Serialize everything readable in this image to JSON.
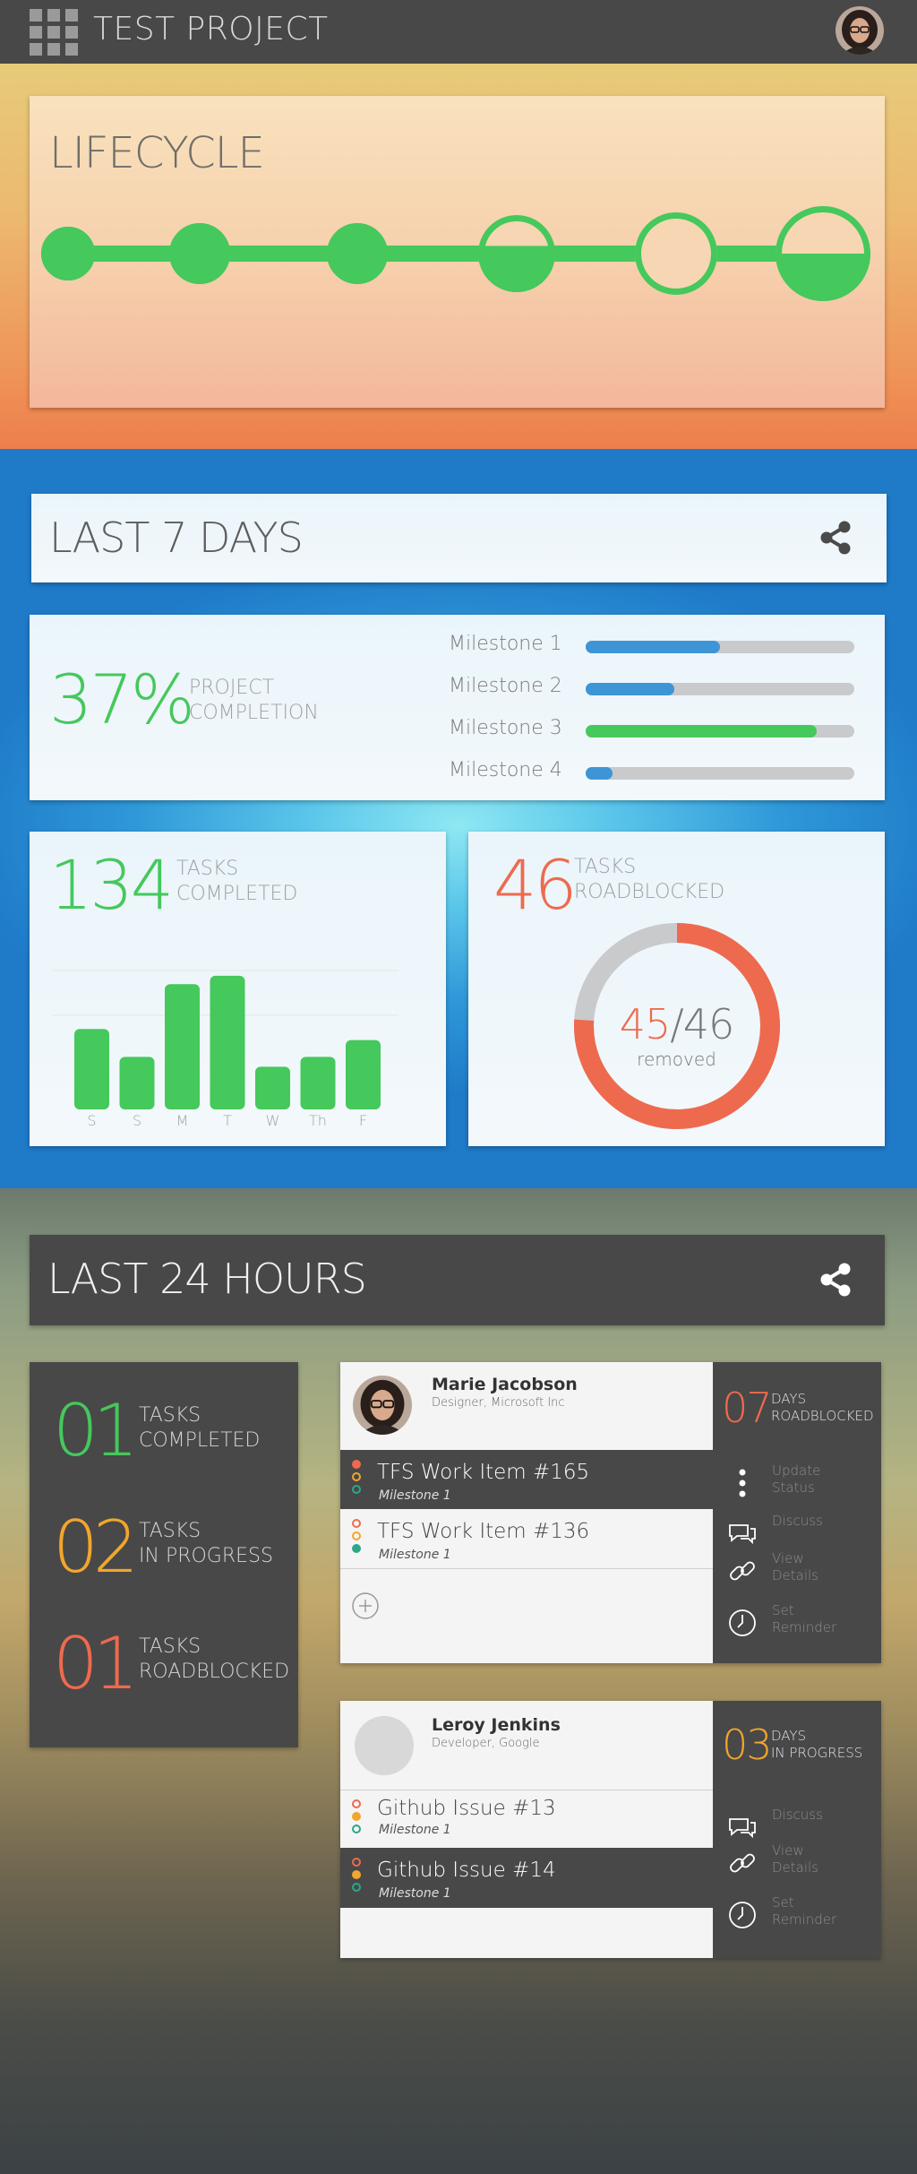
{
  "topbar": {
    "title": "TEST PROJECT"
  },
  "lifecycle": {
    "title": "LIFECYCLE",
    "stages": [
      {
        "fill": 1.0
      },
      {
        "fill": 1.0
      },
      {
        "fill": 1.0
      },
      {
        "fill": 0.6
      },
      {
        "fill": 0.0
      },
      {
        "fill": 0.5
      }
    ]
  },
  "last7": {
    "title": "LAST 7 DAYS",
    "completion": {
      "value": "37%",
      "label_line1": "PROJECT",
      "label_line2": "COMPLETION"
    },
    "milestones": [
      {
        "label": "Milestone 1",
        "progress": 0.5,
        "color": "#3d95d6"
      },
      {
        "label": "Milestone 2",
        "progress": 0.33,
        "color": "#3d95d6"
      },
      {
        "label": "Milestone 3",
        "progress": 0.86,
        "color": "#45c85c"
      },
      {
        "label": "Milestone 4",
        "progress": 0.1,
        "color": "#3d95d6"
      }
    ],
    "tasks_completed": {
      "value": "134",
      "label_line1": "TASKS",
      "label_line2": "COMPLETED"
    },
    "tasks_roadblocked": {
      "value": "46",
      "label_line1": "TASKS",
      "label_line2": "ROADBLOCKED",
      "removed": "45",
      "total": "/46",
      "removed_label": "removed"
    }
  },
  "chart_data": {
    "type": "bar",
    "categories": [
      "S",
      "S",
      "M",
      "T",
      "W",
      "Th",
      "F"
    ],
    "values": [
      5.5,
      3.5,
      8.7,
      9.3,
      2.8,
      3.5,
      4.7
    ],
    "ylim": [
      0,
      10
    ],
    "grid": true,
    "color": "#45c85c"
  },
  "last24": {
    "title": "LAST 24 HOURS",
    "stats": [
      {
        "value": "01",
        "label_line1": "TASKS",
        "label_line2": "COMPLETED",
        "color": "#45c85c"
      },
      {
        "value": "02",
        "label_line1": "TASKS",
        "label_line2": "IN PROGRESS",
        "color": "#f2a62c"
      },
      {
        "value": "01",
        "label_line1": "TASKS",
        "label_line2": "ROADBLOCKED",
        "color": "#ee6a4e"
      }
    ],
    "people": [
      {
        "name": "Marie Jacobson",
        "role": "Designer, Microsoft Inc",
        "days": "07",
        "days_label_line1": "DAYS",
        "days_label_line2": "ROADBLOCKED",
        "days_color": "#ee6a4e",
        "items": [
          {
            "title": "TFS Work Item #165",
            "milestone": "Milestone 1"
          },
          {
            "title": "TFS Work Item #136",
            "milestone": "Milestone 1"
          }
        ],
        "actions": [
          {
            "line1": "Update",
            "line2": "Status",
            "icon": "more-vertical-icon"
          },
          {
            "line1": "Discuss",
            "line2": "",
            "icon": "chat-icon"
          },
          {
            "line1": "View",
            "line2": "Details",
            "icon": "link-icon"
          },
          {
            "line1": "Set",
            "line2": "Reminder",
            "icon": "clock-icon"
          }
        ]
      },
      {
        "name": "Leroy Jenkins",
        "role": "Developer, Google",
        "days": "03",
        "days_label_line1": "DAYS",
        "days_label_line2": "IN PROGRESS",
        "days_color": "#f2a62c",
        "items": [
          {
            "title": "Github Issue #13",
            "milestone": "Milestone 1"
          },
          {
            "title": "Github Issue #14",
            "milestone": "Milestone 1"
          }
        ],
        "actions": [
          {
            "line1": "Discuss",
            "line2": "",
            "icon": "chat-icon"
          },
          {
            "line1": "View",
            "line2": "Details",
            "icon": "link-icon"
          },
          {
            "line1": "Set",
            "line2": "Reminder",
            "icon": "clock-icon"
          }
        ]
      }
    ]
  },
  "colors": {
    "green": "#45c85c",
    "blue": "#3d95d6",
    "red": "#ee6a4e",
    "orange": "#f2a62c",
    "teal": "#2aa88a",
    "dark": "#484848"
  }
}
